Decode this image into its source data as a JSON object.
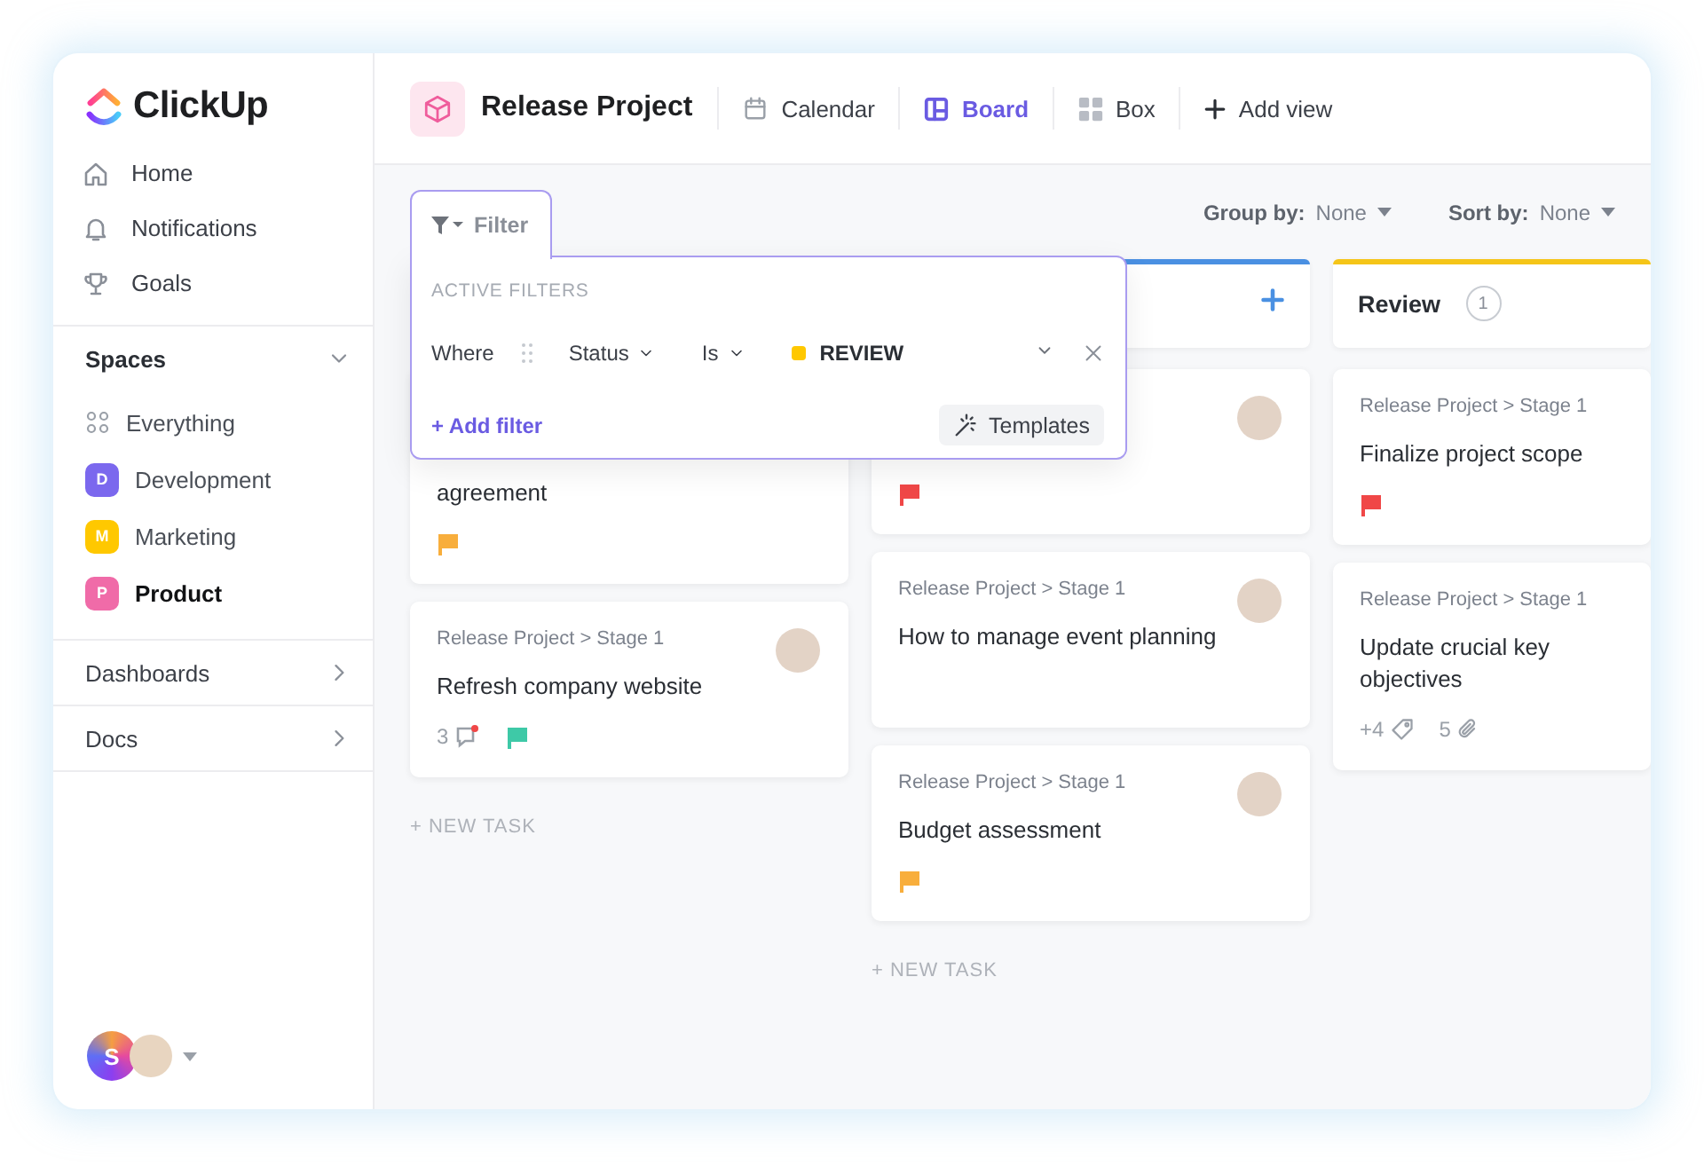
{
  "sidebar": {
    "logo": "ClickUp",
    "nav": [
      {
        "label": "Home",
        "kind": "home"
      },
      {
        "label": "Notifications",
        "kind": "bell"
      },
      {
        "label": "Goals",
        "kind": "trophy"
      }
    ],
    "spaces": {
      "title": "Spaces",
      "expanded": true,
      "items": [
        {
          "label": "Everything",
          "kind": "all",
          "selected": false
        },
        {
          "label": "Development",
          "kind": "space",
          "badge": "D",
          "color": "#7b68ee",
          "selected": false
        },
        {
          "label": "Marketing",
          "kind": "space",
          "badge": "M",
          "color": "#ffc800",
          "selected": false
        },
        {
          "label": "Product",
          "kind": "space",
          "badge": "P",
          "color": "#f06ba8",
          "selected": true
        }
      ]
    },
    "sections": [
      {
        "label": "Dashboards",
        "expanded": false
      },
      {
        "label": "Docs",
        "expanded": false
      }
    ],
    "user": {
      "initial": "S"
    }
  },
  "header": {
    "title": "Release Project",
    "views": [
      {
        "label": "Calendar",
        "kind": "calendar",
        "selected": false
      },
      {
        "label": "Board",
        "kind": "board",
        "selected": true
      },
      {
        "label": "Box",
        "kind": "box",
        "selected": false
      }
    ],
    "add_view": "Add view"
  },
  "toolbar": {
    "filter": "Filter",
    "group_by": {
      "label": "Group by:",
      "value": "None"
    },
    "sort_by": {
      "label": "Sort by:",
      "value": "None"
    }
  },
  "filter_popup": {
    "heading": "ACTIVE FILTERS",
    "where": "Where",
    "field": "Status",
    "operator": "Is",
    "value": {
      "label": "REVIEW",
      "color": "#ffc800"
    },
    "add": "+ Add filter",
    "templates": "Templates"
  },
  "columns": [
    {
      "cards": [
        {
          "title": "agreement",
          "footer": [
            {
              "kind": "flag",
              "color": "#f8ae3c"
            }
          ]
        },
        {
          "path": "Release Project > Stage 1",
          "title": "Refresh company website",
          "assignee_avatar": true,
          "footer": [
            {
              "kind": "comments",
              "count": "3"
            },
            {
              "kind": "flag",
              "color": "#3ec9a7"
            }
          ]
        }
      ],
      "new_task": "+ NEW TASK"
    },
    {
      "header": {
        "color": "#4a90e2"
      },
      "cards": [
        {
          "assignee_avatar": true,
          "footer": [
            {
              "kind": "flag",
              "color": "#f04747"
            }
          ]
        },
        {
          "path": "Release Project > Stage 1",
          "title": "How to manage event planning",
          "assignee_avatar": true
        },
        {
          "path": "Release Project > Stage 1",
          "title": "Budget assessment",
          "assignee_avatar": true,
          "footer": [
            {
              "kind": "flag",
              "color": "#f8ae3c"
            }
          ]
        }
      ],
      "new_task": "+ NEW TASK"
    },
    {
      "header": {
        "title": "Review",
        "count": "1",
        "color": "#f5c518"
      },
      "cards": [
        {
          "path": "Release Project > Stage 1",
          "title": "Finalize project scope",
          "footer": [
            {
              "kind": "flag",
              "color": "#f04747"
            }
          ]
        },
        {
          "path": "Release Project > Stage 1",
          "title": "Update crucial key objectives",
          "footer": [
            {
              "kind": "tags",
              "count": "+4"
            },
            {
              "kind": "attachments",
              "count": "5"
            }
          ]
        }
      ]
    }
  ]
}
